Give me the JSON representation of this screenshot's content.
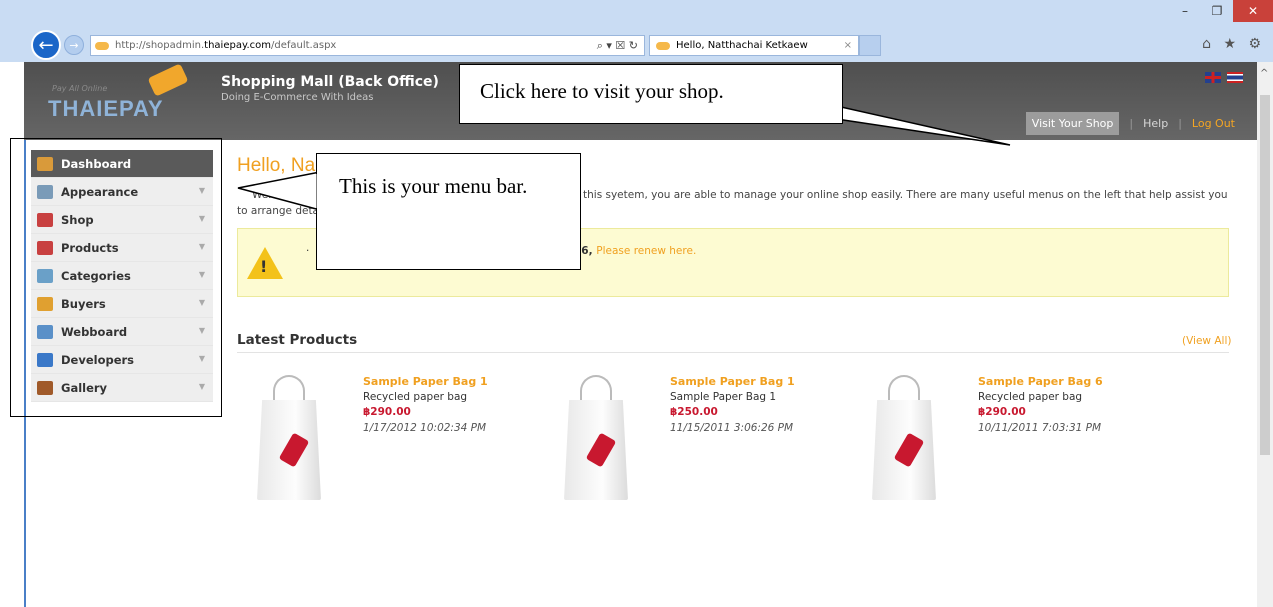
{
  "browser": {
    "url_prefix": "http://shopadmin.",
    "url_host": "thaiepay.com",
    "url_path": "/default.aspx",
    "address_tools": "⌕ ▾ ☒ ↻",
    "tab_title": "Hello, Natthachai Ketkaew",
    "tab_close": "×",
    "window_minimize": "–",
    "window_restore": "❐",
    "window_close": "✕",
    "back": "←",
    "forward": "→",
    "right_icons": "⌂ ★ ⚙"
  },
  "header": {
    "logo_sub": "Pay All Online",
    "logo": "THAIEPAY",
    "title": "Shopping Mall (Back Office)",
    "subtitle": "Doing E-Commerce With Ideas",
    "visit_shop": "Visit Your Shop",
    "sep": "|",
    "help": "Help",
    "logout": "Log Out"
  },
  "sidebar": {
    "items": [
      {
        "label": "Dashboard",
        "icon": "home-icon",
        "color": "#d99a3a"
      },
      {
        "label": "Appearance",
        "icon": "monitor-icon",
        "color": "#7a9bb8"
      },
      {
        "label": "Shop",
        "icon": "shop-icon",
        "color": "#c84040"
      },
      {
        "label": "Products",
        "icon": "gift-icon",
        "color": "#c84040"
      },
      {
        "label": "Categories",
        "icon": "tree-icon",
        "color": "#6aa0c8"
      },
      {
        "label": "Buyers",
        "icon": "users-icon",
        "color": "#e0a030"
      },
      {
        "label": "Webboard",
        "icon": "chat-icon",
        "color": "#5a90c8"
      },
      {
        "label": "Developers",
        "icon": "help-icon",
        "color": "#3a78c8"
      },
      {
        "label": "Gallery",
        "icon": "picture-icon",
        "color": "#a05a2a"
      }
    ],
    "chevron": "▼"
  },
  "main": {
    "hello": "Hello, Na",
    "welcome_start": "Welcom",
    "welcome_cont": "this syetem, you are able to manage your online shop easily. There are many useful menus on the left that help assist you",
    "welcome_line2": "to arrange deta",
    "notice_bullet": "· ",
    "notice_bold": "16",
    "notice_sep": ", ",
    "notice_link": "Please renew here.",
    "warn_mark": "!",
    "latest_title": "Latest Products",
    "view_all": "(View All)"
  },
  "products": [
    {
      "name": "Sample Paper Bag 1",
      "desc": "Recycled paper bag",
      "price": "฿290.00",
      "date": "1/17/2012 10:02:34 PM"
    },
    {
      "name": "Sample Paper Bag 1",
      "desc": "Sample Paper Bag 1",
      "price": "฿250.00",
      "date": "11/15/2011 3:06:26 PM"
    },
    {
      "name": "Sample Paper Bag 6",
      "desc": "Recycled paper bag",
      "price": "฿290.00",
      "date": "10/11/2011 7:03:31 PM"
    }
  ],
  "callouts": {
    "shop": "Click here to visit your shop.",
    "menu": "This is your menu bar."
  }
}
